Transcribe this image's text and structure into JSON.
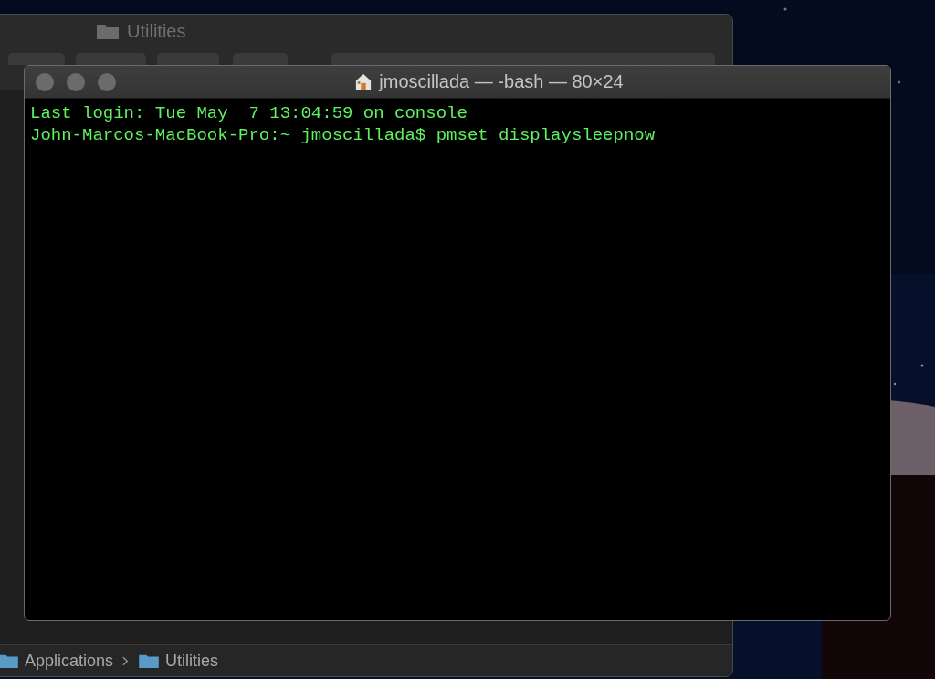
{
  "finder": {
    "title": "Utilities",
    "path": [
      "Applications",
      "Utilities"
    ]
  },
  "terminal": {
    "title": "jmoscillada — -bash — 80×24",
    "lines": [
      "Last login: Tue May  7 13:04:59 on console",
      "John-Marcos-MacBook-Pro:~ jmoscillada$ pmset displaysleepnow"
    ]
  }
}
